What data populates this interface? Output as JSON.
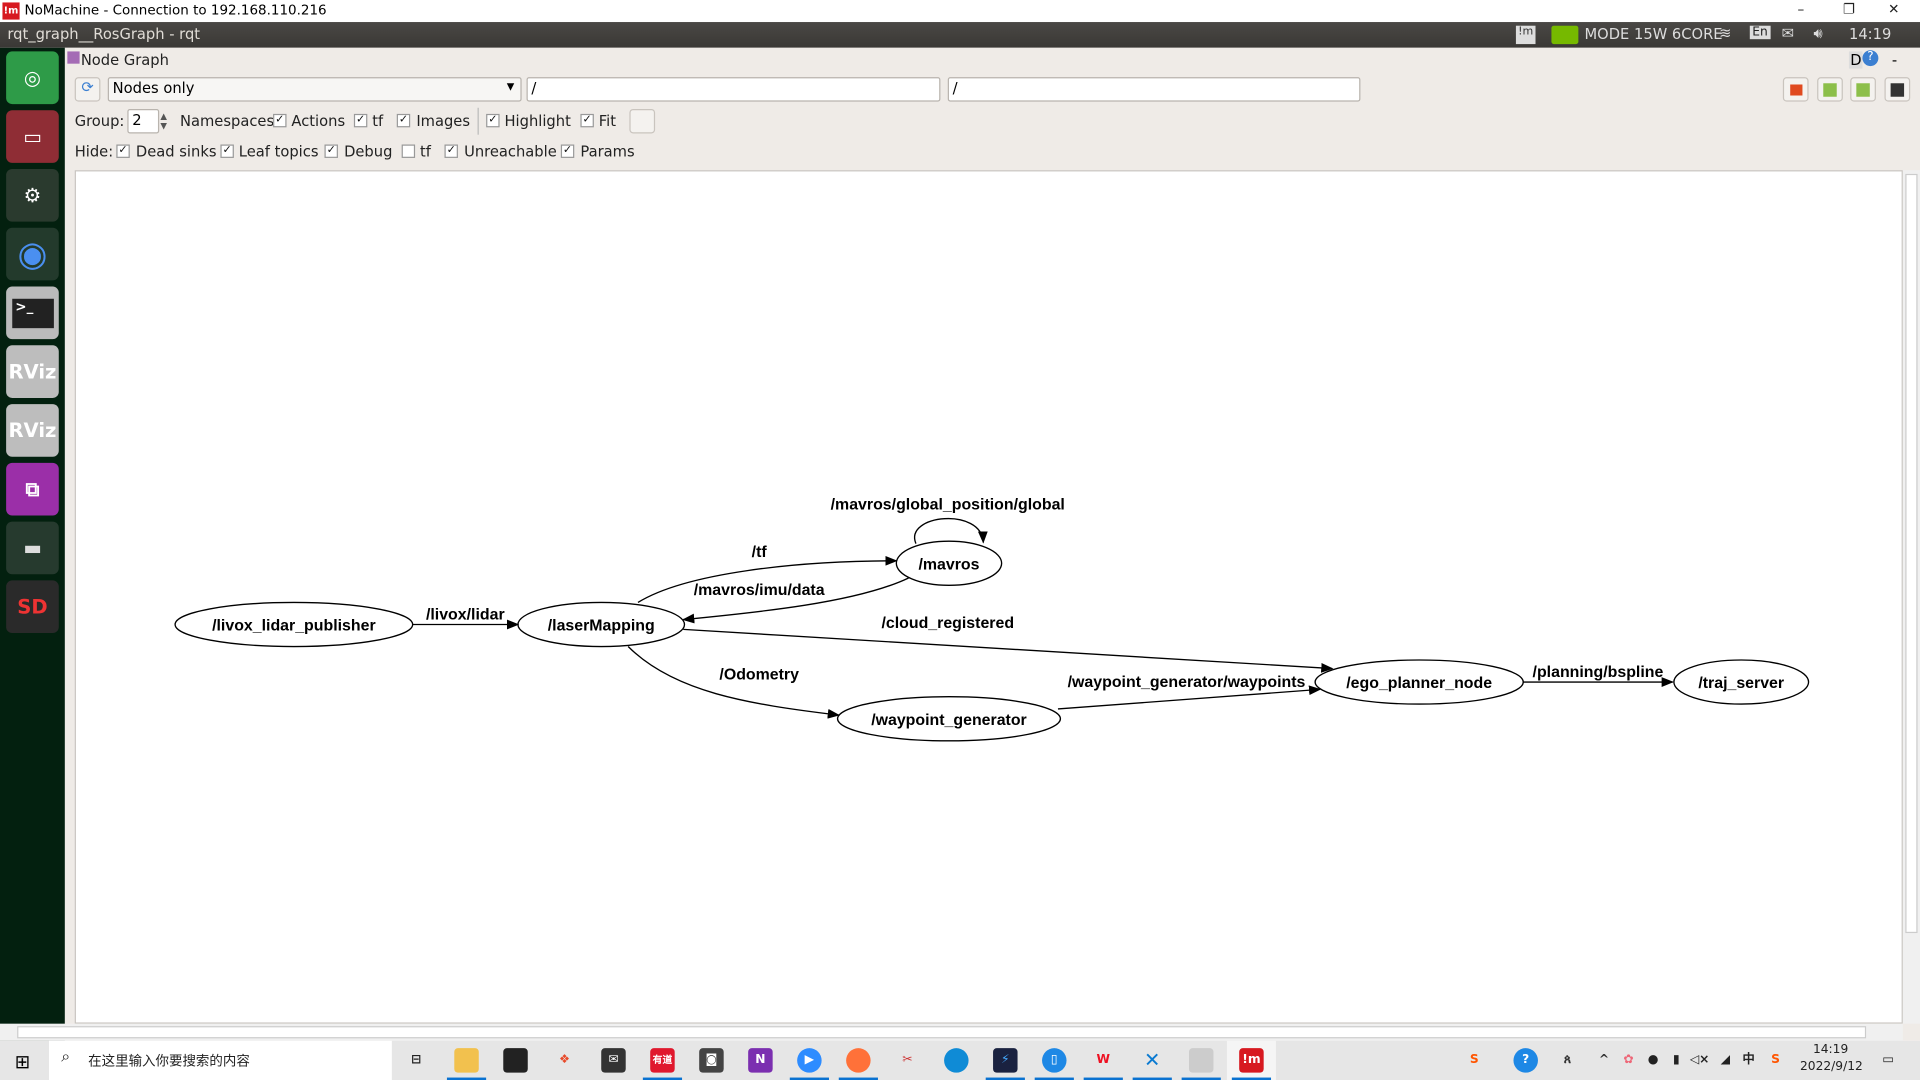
{
  "window": {
    "title": "NoMachine - Connection to 192.168.110.216",
    "logo": "!m"
  },
  "ubuntu_bar": {
    "title": "rqt_graph__RosGraph - rqt",
    "mode": "MODE 15W 6CORE",
    "lang": "En",
    "time": "14:19"
  },
  "launcher": [
    "ubuntu-dash",
    "files",
    "system-settings",
    "chromium",
    "terminal",
    "rviz",
    "rviz",
    "remote-desktop",
    "drive",
    "sd-card"
  ],
  "plugin": {
    "title": "Node Graph",
    "help": "D"
  },
  "toolbar": {
    "view_mode": "Nodes only",
    "ns_filter": "/",
    "topic_filter": "/"
  },
  "options": {
    "group_label": "Group:",
    "group_value": "2",
    "items": [
      {
        "label": "Namespaces",
        "checked": null
      },
      {
        "label": "Actions",
        "checked": true
      },
      {
        "label": "tf",
        "checked": true
      },
      {
        "label": "Images",
        "checked": true
      },
      {
        "label": "Highlight",
        "checked": true
      },
      {
        "label": "Fit",
        "checked": true
      }
    ]
  },
  "hide": {
    "label": "Hide:",
    "items": [
      {
        "label": "Dead sinks",
        "checked": true
      },
      {
        "label": "Leaf topics",
        "checked": true
      },
      {
        "label": "Debug",
        "checked": true
      },
      {
        "label": "tf",
        "checked": false
      },
      {
        "label": "Unreachable",
        "checked": true
      },
      {
        "label": "Params",
        "checked": true
      }
    ]
  },
  "graph": {
    "nodes": [
      "/livox_lidar_publisher",
      "/laserMapping",
      "/mavros",
      "/waypoint_generator",
      "/ego_planner_node",
      "/traj_server"
    ],
    "edges": [
      {
        "from": "/livox_lidar_publisher",
        "to": "/laserMapping",
        "label": "/livox/lidar"
      },
      {
        "from": "/laserMapping",
        "to": "/mavros",
        "label": "/tf"
      },
      {
        "from": "/mavros",
        "to": "/laserMapping",
        "label": "/mavros/imu/data"
      },
      {
        "from": "/mavros",
        "to": "/mavros",
        "label": "/mavros/global_position/global"
      },
      {
        "from": "/laserMapping",
        "to": "/ego_planner_node",
        "label": "/cloud_registered"
      },
      {
        "from": "/laserMapping",
        "to": "/waypoint_generator",
        "label": "/Odometry"
      },
      {
        "from": "/waypoint_generator",
        "to": "/ego_planner_node",
        "label": "/waypoint_generator/waypoints"
      },
      {
        "from": "/ego_planner_node",
        "to": "/traj_server",
        "label": "/planning/bspline"
      }
    ]
  },
  "taskbar": {
    "search_placeholder": "在这里输入你要搜索的内容",
    "time": "14:19",
    "date": "2022/9/12",
    "youdao": "有道"
  }
}
